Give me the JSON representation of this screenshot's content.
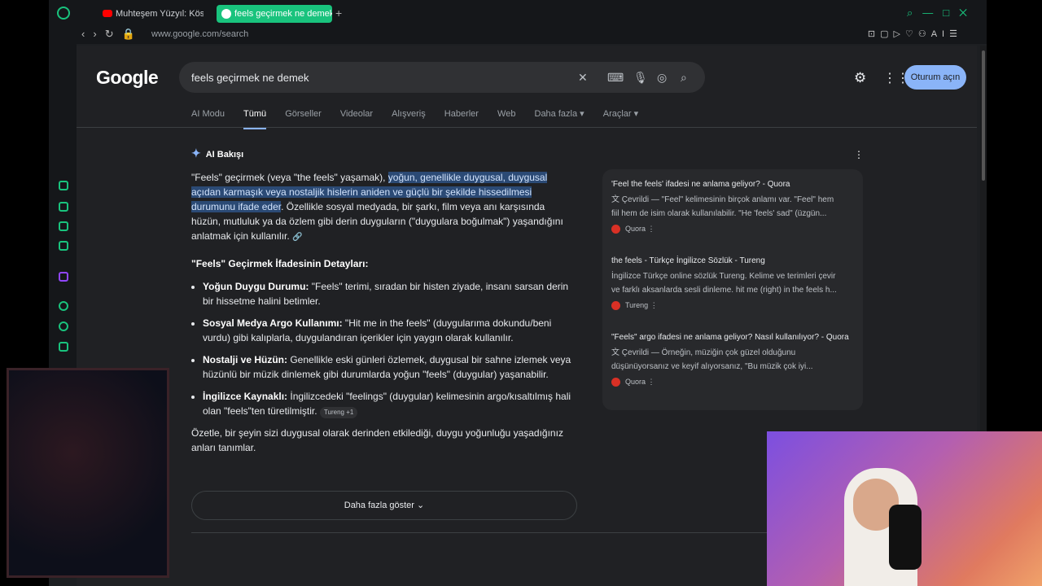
{
  "browser": {
    "tabs": [
      {
        "label": "Muhteşem Yüzyıl: Kösem Sultan"
      },
      {
        "label": "feels geçirmek ne demek"
      }
    ],
    "url": "www.google.com/search",
    "ai_label": "AI"
  },
  "google": {
    "logo": "Google",
    "query": "feels geçirmek ne demek",
    "signin_label": "Oturum açın",
    "tabs": [
      "AI Modu",
      "Tümü",
      "Görseller",
      "Videolar",
      "Alışveriş",
      "Haberler",
      "Web",
      "Daha fazla ▾",
      "Araçlar ▾"
    ],
    "active_tab": "Tümü"
  },
  "ai_overview": {
    "heading": "AI Bakışı",
    "intro_plain": "\"Feels\" geçirmek (veya \"the feels\" yaşamak), ",
    "intro_highlight": "yoğun, genellikle duygusal, duygusal açıdan karmaşık veya nostaljik hislerin aniden ve güçlü bir şekilde hissedilmesi durumunu ifade eder",
    "intro_rest": ". Özellikle sosyal medyada, bir şarkı, film veya anı karşısında hüzün, mutluluk ya da özlem gibi derin duyguların (\"duygulara boğulmak\") yaşandığını anlatmak için kullanılır.",
    "details_heading": "\"Feels\" Geçirmek İfadesinin Detayları:",
    "items": [
      {
        "title": "Yoğun Duygu Durumu:",
        "text": " \"Feels\" terimi, sıradan bir histen ziyade, insanı sarsan derin bir hissetme halini betimler."
      },
      {
        "title": "Sosyal Medya Argo Kullanımı:",
        "text": " \"Hit me in the feels\" (duygularıma dokundu/beni vurdu) gibi kalıplarla, duygulandıran içerikler için yaygın olarak kullanılır."
      },
      {
        "title": "Nostalji ve Hüzün:",
        "text": " Genellikle eski günleri özlemek, duygusal bir sahne izlemek veya hüzünlü bir müzik dinlemek gibi durumlarda yoğun \"feels\" (duygular) yaşanabilir."
      },
      {
        "title": "İngilizce Kaynaklı:",
        "text": " İngilizcedeki \"feelings\" (duygular) kelimesinin argo/kısaltılmış hali olan \"feels\"ten türetilmiştir."
      }
    ],
    "chip": "Tureng +1",
    "summary": "Özetle, bir şeyin sizi duygusal olarak derinden etkilediği, duygu yoğunluğu yaşadığınız anları tanımlar.",
    "more_label": "Daha fazla göster"
  },
  "sources": [
    {
      "title": "'Feel the feels' ifadesi ne anlama geliyor? - Quora",
      "desc1": "Çevrildi — \"Feel\" kelimesinin birçok anlamı var. \"Feel\" hem",
      "desc2": "fiil hem de isim olarak kullanılabilir. \"He 'feels' sad\" (üzgün...",
      "site": "Quora"
    },
    {
      "title": "the feels - Türkçe İngilizce Sözlük - Tureng",
      "desc1": "İngilizce Türkçe online sözlük Tureng. Kelime ve terimleri çevir",
      "desc2": "ve farklı aksanlarda sesli dinleme. hit me (right) in the feels h...",
      "site": "Tureng"
    },
    {
      "title": "\"Feels\" argo ifadesi ne anlama geliyor? Nasıl kullanılıyor? - Quora",
      "desc1": "Çevrildi — Örneğin, müziğin çok güzel olduğunu",
      "desc2": "düşünüyorsanız ve keyif alıyorsanız, \"Bu müzik çok iyi...",
      "site": "Quora"
    }
  ],
  "colors": {
    "accent": "#19c37d",
    "link": "#8ab4f8",
    "background": "#202124"
  }
}
